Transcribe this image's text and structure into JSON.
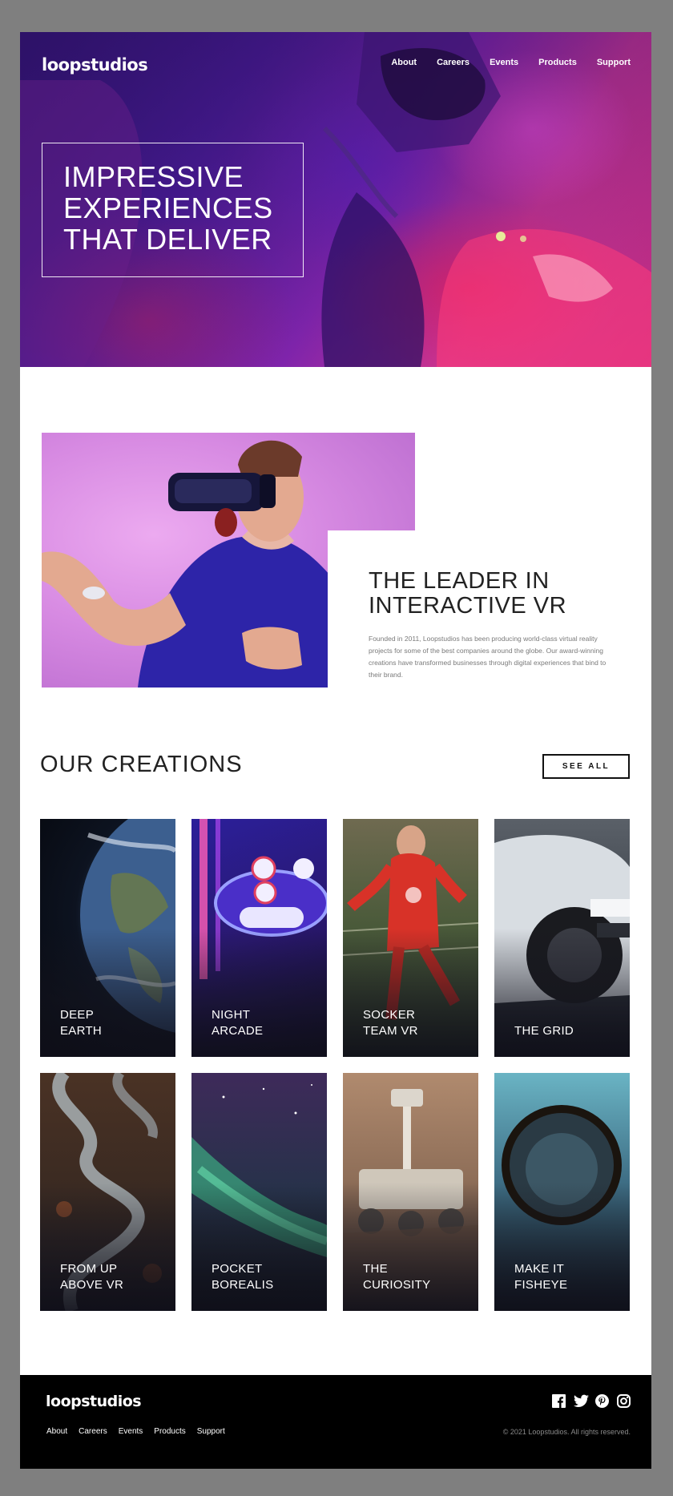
{
  "brand": {
    "logo": "loopstudios"
  },
  "nav": {
    "items": [
      "About",
      "Careers",
      "Events",
      "Products",
      "Support"
    ]
  },
  "hero": {
    "title": "IMPRESSIVE\nEXPERIENCES\nTHAT DELIVER"
  },
  "leader": {
    "title": "THE LEADER IN\nINTERACTIVE VR",
    "body": "Founded in 2011, Loopstudios has been producing world-class virtual reality projects for some of the best companies around the globe. Our award-winning creations have transformed businesses through digital experiences that bind to their brand."
  },
  "creations": {
    "title": "OUR CREATIONS",
    "see_all": "SEE ALL",
    "cards": [
      {
        "label": "DEEP\nEARTH",
        "icon": "earth-image"
      },
      {
        "label": "NIGHT\nARCADE",
        "icon": "arcade-image"
      },
      {
        "label": "SOCKER\nTEAM VR",
        "icon": "soccer-image"
      },
      {
        "label": "THE GRID",
        "icon": "race-car-image"
      },
      {
        "label": "FROM UP\nABOVE VR",
        "icon": "aerial-road-image"
      },
      {
        "label": "POCKET\nBOREALIS",
        "icon": "aurora-image"
      },
      {
        "label": "THE\nCURIOSITY",
        "icon": "rover-image"
      },
      {
        "label": "MAKE IT\nFISHEYE",
        "icon": "fisheye-image"
      }
    ]
  },
  "footer": {
    "logo": "loopstudios",
    "nav": [
      "About",
      "Careers",
      "Events",
      "Products",
      "Support"
    ],
    "social_icons": [
      "facebook-icon",
      "twitter-icon",
      "pinterest-icon",
      "instagram-icon"
    ],
    "copyright": "© 2021 Loopstudios. All rights reserved."
  },
  "colors": {
    "page_bg": "#7f7f7f",
    "text_dark": "#222222",
    "text_muted": "#7a7a7a",
    "footer_bg": "#000000"
  }
}
